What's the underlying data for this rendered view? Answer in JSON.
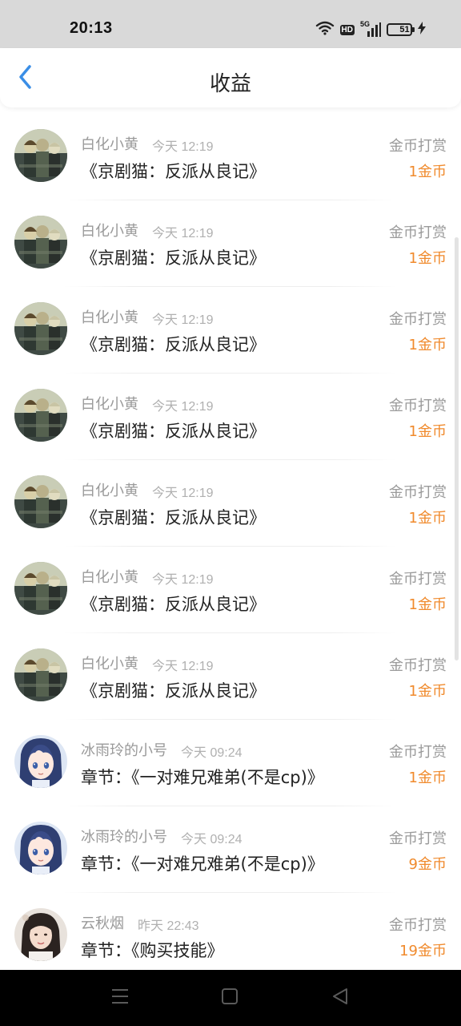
{
  "status_bar": {
    "time": "20:13",
    "hd": "HD",
    "network": "5G",
    "battery": "51",
    "battery_level": 0.51
  },
  "header": {
    "title": "收益",
    "back_icon": "chevron-left-icon",
    "accent_color": "#3a8ee6"
  },
  "items": [
    {
      "avatar": "group-photo-avatar",
      "username": "白化小黄",
      "time": "今天 12:19",
      "title": "《京剧猫：反派从良记》",
      "reward_type": "金币打赏",
      "amount": "1金币"
    },
    {
      "avatar": "group-photo-avatar",
      "username": "白化小黄",
      "time": "今天 12:19",
      "title": "《京剧猫：反派从良记》",
      "reward_type": "金币打赏",
      "amount": "1金币"
    },
    {
      "avatar": "group-photo-avatar",
      "username": "白化小黄",
      "time": "今天 12:19",
      "title": "《京剧猫：反派从良记》",
      "reward_type": "金币打赏",
      "amount": "1金币"
    },
    {
      "avatar": "group-photo-avatar",
      "username": "白化小黄",
      "time": "今天 12:19",
      "title": "《京剧猫：反派从良记》",
      "reward_type": "金币打赏",
      "amount": "1金币"
    },
    {
      "avatar": "group-photo-avatar",
      "username": "白化小黄",
      "time": "今天 12:19",
      "title": "《京剧猫：反派从良记》",
      "reward_type": "金币打赏",
      "amount": "1金币"
    },
    {
      "avatar": "group-photo-avatar",
      "username": "白化小黄",
      "time": "今天 12:19",
      "title": "《京剧猫：反派从良记》",
      "reward_type": "金币打赏",
      "amount": "1金币"
    },
    {
      "avatar": "group-photo-avatar",
      "username": "白化小黄",
      "time": "今天 12:19",
      "title": "《京剧猫：反派从良记》",
      "reward_type": "金币打赏",
      "amount": "1金币"
    },
    {
      "avatar": "anime-girl-avatar",
      "username": "冰雨玲的小号",
      "time": "今天 09:24",
      "title": "章节：《一对难兄难弟(不是cp)》",
      "reward_type": "金币打赏",
      "amount": "1金币"
    },
    {
      "avatar": "anime-girl-avatar",
      "username": "冰雨玲的小号",
      "time": "今天 09:24",
      "title": "章节：《一对难兄难弟(不是cp)》",
      "reward_type": "金币打赏",
      "amount": "9金币"
    },
    {
      "avatar": "portrait-avatar",
      "username": "云秋烟",
      "time": "昨天 22:43",
      "title": "章节：《购买技能》",
      "reward_type": "金币打赏",
      "amount": "19金币"
    }
  ],
  "colors": {
    "amount": "#f08a2c",
    "muted_text": "#9a9a9a",
    "title_text": "#222222"
  },
  "nav_bar": {
    "icons": [
      "menu-icon",
      "home-square-icon",
      "back-triangle-icon"
    ]
  }
}
